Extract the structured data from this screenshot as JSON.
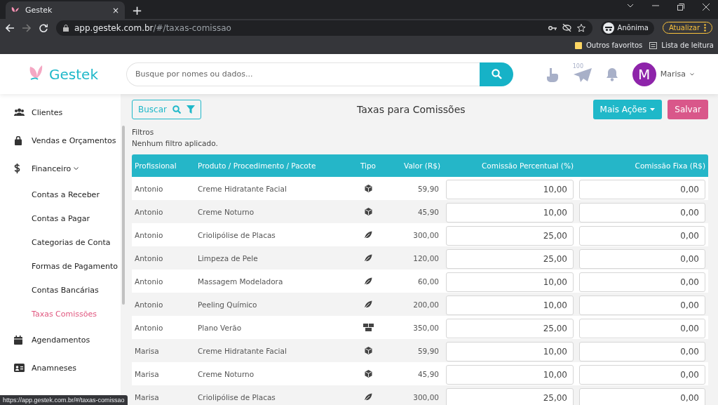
{
  "browser": {
    "tab_title": "Gestek",
    "tab_close": "×",
    "new_tab": "+",
    "url_host": "app.gestek.com.br",
    "url_path": "/#/taxas-comissao",
    "profile": "Anônima",
    "update_button": "Atualizar",
    "bookmarks": [
      "Outros favoritos",
      "Lista de leitura"
    ],
    "status_url": "https://app.gestek.com.br/#/taxas-comissao"
  },
  "header": {
    "logo": "Gestek",
    "search": {
      "placeholder": "Busque por nomes ou dados..."
    },
    "notification_count": "100",
    "user_initial": "M",
    "user_name": "Marisa"
  },
  "sidebar": {
    "items": [
      {
        "label": "Clientes",
        "kind": "users",
        "selected": false
      },
      {
        "label": "Vendas e Orçamentos",
        "kind": "bag",
        "selected": false
      },
      {
        "label": "Financeiro",
        "kind": "dollar",
        "selected": false,
        "expanded": true,
        "children": [
          {
            "label": "Contas a Receber",
            "selected": false
          },
          {
            "label": "Contas a Pagar",
            "selected": false
          },
          {
            "label": "Categorias de Conta",
            "selected": false
          },
          {
            "label": "Formas de Pagamento",
            "selected": false
          },
          {
            "label": "Contas Bancárias",
            "selected": false
          },
          {
            "label": "Taxas Comissões",
            "selected": true
          }
        ]
      },
      {
        "label": "Agendamentos",
        "kind": "calendar",
        "selected": false
      },
      {
        "label": "Anamneses",
        "kind": "card",
        "selected": false
      }
    ]
  },
  "page": {
    "title": "Taxas para Comissões",
    "search_button": "Buscar",
    "more_button": "Mais Ações",
    "save_button": "Salvar",
    "filters_label": "Filtros",
    "filters_text": "Nenhum filtro aplicado."
  },
  "table": {
    "columns": [
      "Profissional",
      "Produto / Procedimento / Pacote",
      "Tipo",
      "Valor (R$)",
      "Comissão Percentual (%)",
      "Comissão Fixa (R$)"
    ],
    "rows": [
      {
        "professional": "Antonio",
        "item": "Creme Hidratante Facial",
        "kind": "product",
        "value": "59,90",
        "percent": "10,00",
        "fixed": "0,00"
      },
      {
        "professional": "Antonio",
        "item": "Creme Noturno",
        "kind": "product",
        "value": "45,90",
        "percent": "10,00",
        "fixed": "0,00"
      },
      {
        "professional": "Antonio",
        "item": "Criolipólise de Placas",
        "kind": "procedure",
        "value": "300,00",
        "percent": "25,00",
        "fixed": "0,00"
      },
      {
        "professional": "Antonio",
        "item": "Limpeza de Pele",
        "kind": "procedure",
        "value": "120,00",
        "percent": "25,00",
        "fixed": "0,00"
      },
      {
        "professional": "Antonio",
        "item": "Massagem Modeladora",
        "kind": "procedure",
        "value": "60,00",
        "percent": "10,00",
        "fixed": "0,00"
      },
      {
        "professional": "Antonio",
        "item": "Peeling Químico",
        "kind": "procedure",
        "value": "200,00",
        "percent": "10,00",
        "fixed": "0,00"
      },
      {
        "professional": "Antonio",
        "item": "Plano Verão",
        "kind": "package",
        "value": "350,00",
        "percent": "25,00",
        "fixed": "0,00"
      },
      {
        "professional": "Marisa",
        "item": "Creme Hidratante Facial",
        "kind": "product",
        "value": "59,90",
        "percent": "10,00",
        "fixed": "0,00"
      },
      {
        "professional": "Marisa",
        "item": "Creme Noturno",
        "kind": "product",
        "value": "45,90",
        "percent": "10,00",
        "fixed": "0,00"
      },
      {
        "professional": "Marisa",
        "item": "Criolipólise de Placas",
        "kind": "procedure",
        "value": "300,00",
        "percent": "25,00",
        "fixed": "0,00"
      }
    ]
  }
}
